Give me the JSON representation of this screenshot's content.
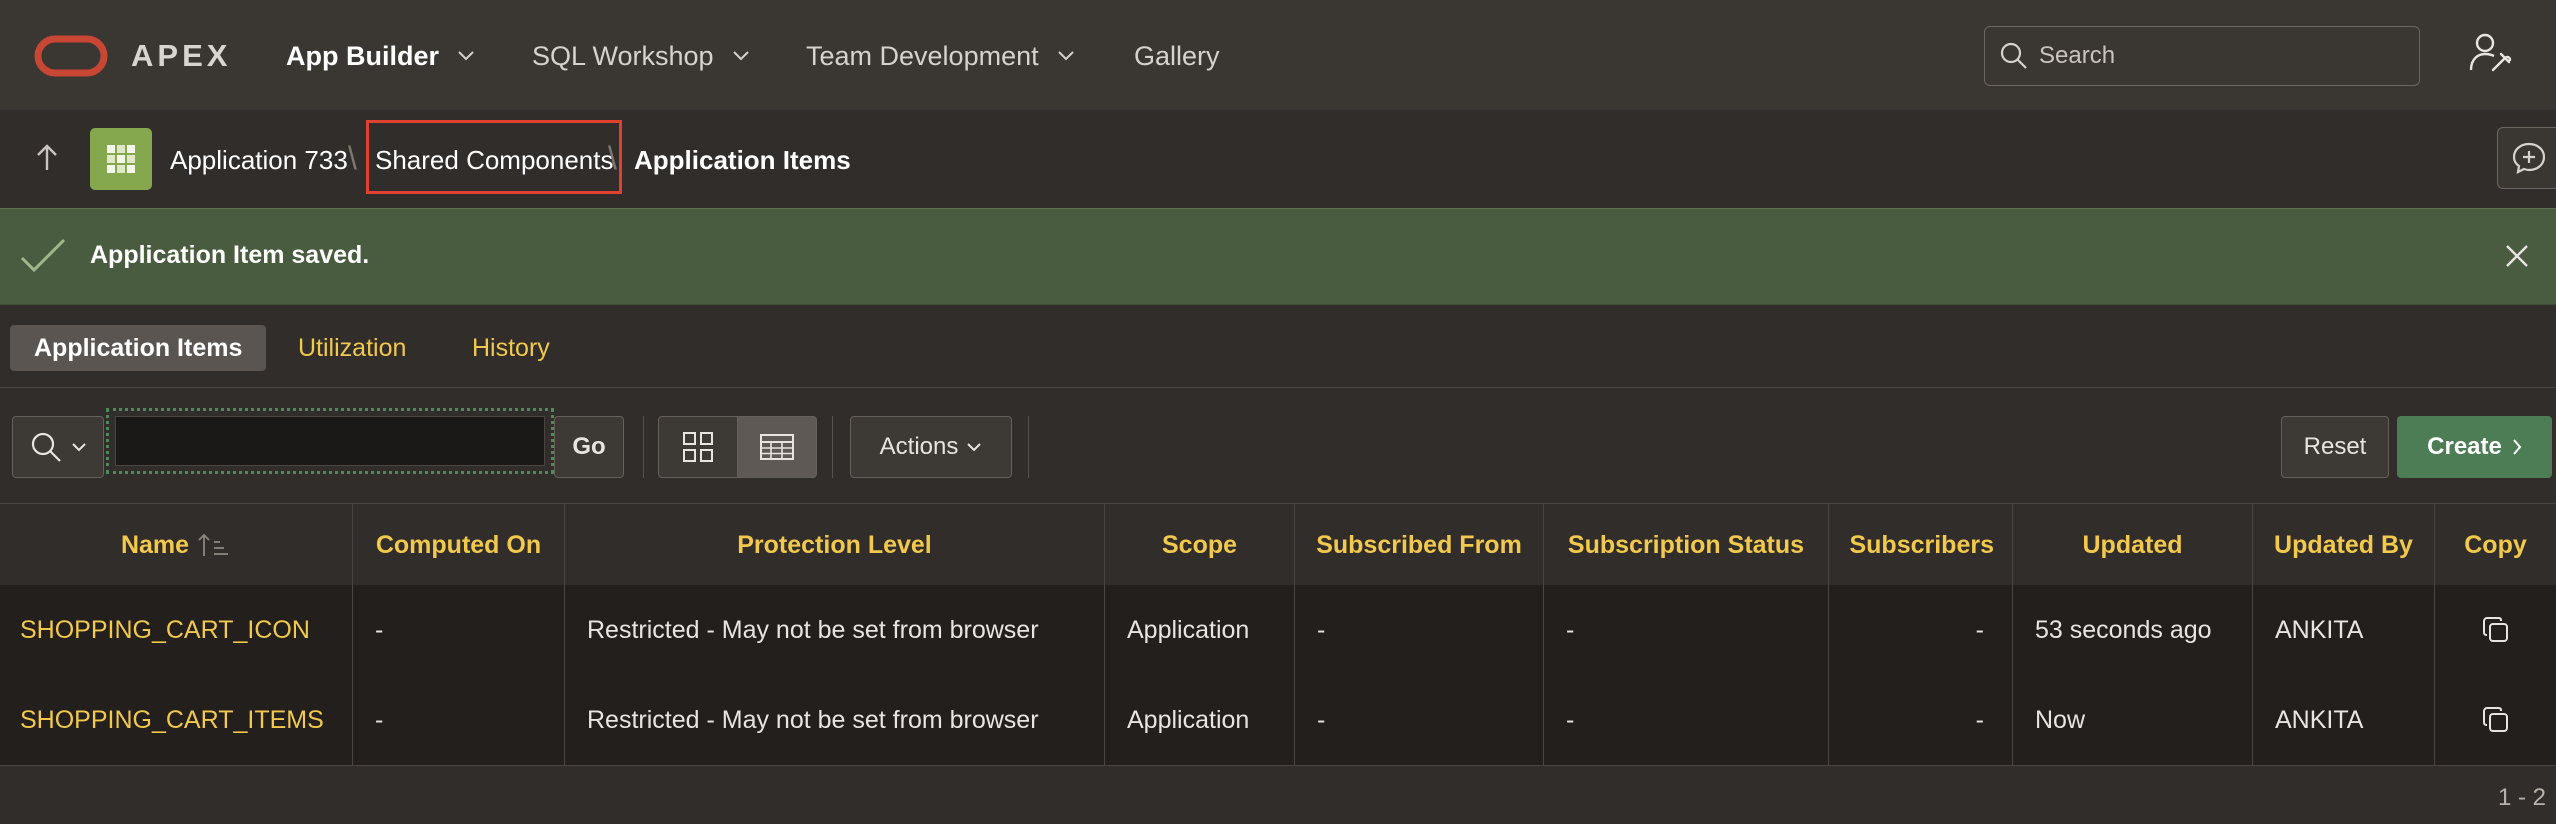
{
  "app": {
    "brand": "APEX"
  },
  "nav": {
    "items": [
      {
        "label": "App Builder",
        "has_menu": true,
        "active": true
      },
      {
        "label": "SQL Workshop",
        "has_menu": true
      },
      {
        "label": "Team Development",
        "has_menu": true
      },
      {
        "label": "Gallery",
        "has_menu": false
      }
    ],
    "search_placeholder": "Search"
  },
  "breadcrumb": {
    "items": [
      "Application 733",
      "Shared Components",
      "Application Items"
    ]
  },
  "alert": {
    "message": "Application Item saved.",
    "type": "success"
  },
  "tabs": [
    "Application Items",
    "Utilization",
    "History"
  ],
  "toolbar": {
    "go_label": "Go",
    "actions_label": "Actions",
    "reset_label": "Reset",
    "create_label": "Create"
  },
  "table": {
    "columns": [
      "Name",
      "Computed On",
      "Protection Level",
      "Scope",
      "Subscribed From",
      "Subscription Status",
      "Subscribers",
      "Updated",
      "Updated By",
      "Copy"
    ],
    "rows": [
      {
        "name": "SHOPPING_CART_ICON",
        "computed_on": "-",
        "protection": "Restricted - May not be set from browser",
        "scope": "Application",
        "subscribed_from": "-",
        "subscription_status": "-",
        "subscribers": "-",
        "updated": "53 seconds ago",
        "updated_by": "ANKITA"
      },
      {
        "name": "SHOPPING_CART_ITEMS",
        "computed_on": "-",
        "protection": "Restricted - May not be set from browser",
        "scope": "Application",
        "subscribed_from": "-",
        "subscription_status": "-",
        "subscribers": "-",
        "updated": "Now",
        "updated_by": "ANKITA"
      }
    ],
    "pagination": "1 - 2"
  },
  "colors": {
    "accent_yellow": "#f2c94c",
    "success_bg": "#4a5c3f",
    "create_green": "#4c7d55",
    "highlight_red": "#e0422f",
    "oracle_red": "#c74634",
    "app_icon_green": "#85a84e"
  }
}
